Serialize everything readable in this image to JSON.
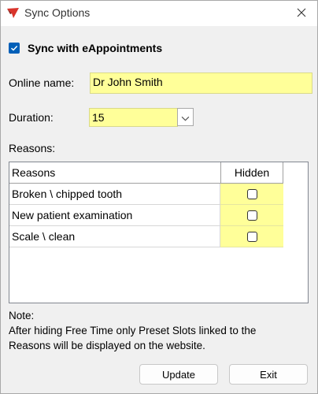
{
  "window": {
    "title": "Sync Options"
  },
  "sync": {
    "label": "Sync with eAppointments",
    "checked": true
  },
  "online_name": {
    "label": "Online name:",
    "value": "Dr John Smith"
  },
  "duration": {
    "label": "Duration:",
    "value": "15"
  },
  "reasons": {
    "section_label": "Reasons:",
    "columns": [
      "Reasons",
      "Hidden"
    ],
    "rows": [
      {
        "reason": "Broken \\ chipped tooth",
        "hidden": false
      },
      {
        "reason": "New patient examination",
        "hidden": false
      },
      {
        "reason": "Scale \\ clean",
        "hidden": false
      }
    ]
  },
  "note": {
    "heading": "Note:",
    "line1": "After hiding Free Time only Preset Slots linked to the",
    "line2": "Reasons will be displayed on the website."
  },
  "buttons": {
    "update": "Update",
    "exit": "Exit"
  },
  "colors": {
    "field_highlight": "#ffff99",
    "checkbox_accent": "#005fb8"
  },
  "icons": {
    "app": "app-logo-icon",
    "close": "close-icon",
    "dropdown": "chevron-down-icon",
    "check": "checkmark-icon"
  }
}
